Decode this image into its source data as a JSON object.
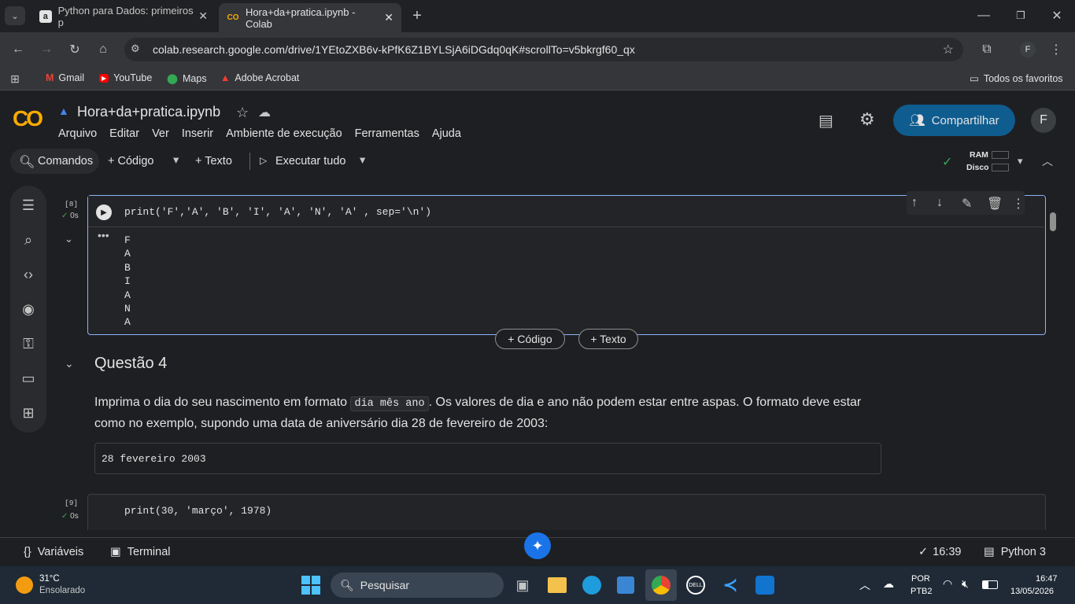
{
  "browser": {
    "tabs": [
      {
        "title": "Python para Dados: primeiros p"
      },
      {
        "title": "Hora+da+pratica.ipynb - Colab"
      }
    ],
    "url": "colab.research.google.com/drive/1YEtoZXB6v-kPfK6Z1BYLSjA6iDGdq0qK#scrollTo=v5bkrgf60_qx",
    "bookmarks": [
      "Gmail",
      "YouTube",
      "Maps",
      "Adobe Acrobat"
    ],
    "all_bookmarks": "Todos os favoritos",
    "profile": "F"
  },
  "colab": {
    "logo": "CO",
    "filename": "Hora+da+pratica.ipynb",
    "menu": [
      "Arquivo",
      "Editar",
      "Ver",
      "Inserir",
      "Ambiente de execução",
      "Ferramentas",
      "Ajuda"
    ],
    "share": "Compartilhar",
    "avatar": "F",
    "toolbar": {
      "commands": "Comandos",
      "code": "+ Código",
      "text": "+ Texto",
      "run_all": "Executar tudo",
      "ram": "RAM",
      "disk": "Disco"
    }
  },
  "cell1": {
    "exec": "[8]",
    "time": "0s",
    "code": "print('F','A', 'B', 'I', 'A', 'N', 'A' , sep='\\n')",
    "output": [
      "F",
      "A",
      "B",
      "I",
      "A",
      "N",
      "A"
    ]
  },
  "add_buttons": {
    "code": "+ Código",
    "text": "+ Texto"
  },
  "section": {
    "title": "Questão 4",
    "p1": "Imprima o dia do seu nascimento em formato ",
    "code": "dia mês ano",
    "p2": ". Os valores de dia e ano não podem estar entre aspas. O formato deve estar",
    "p3": "como no exemplo, supondo uma data de aniversário dia 28 de fevereiro de 2003:",
    "example": "28 fevereiro 2003"
  },
  "cell2": {
    "exec": "[9]",
    "time": "0s",
    "code": "print(30, 'março', 1978)"
  },
  "bottom": {
    "variables": "Variáveis",
    "terminal": "Terminal",
    "time": "16:39",
    "runtime": "Python 3"
  },
  "taskbar": {
    "temp": "31°C",
    "weather": "Ensolarado",
    "search": "Pesquisar",
    "lang1": "POR",
    "lang2": "PTB2",
    "clock": "16:47",
    "date": "13/05/2026"
  }
}
